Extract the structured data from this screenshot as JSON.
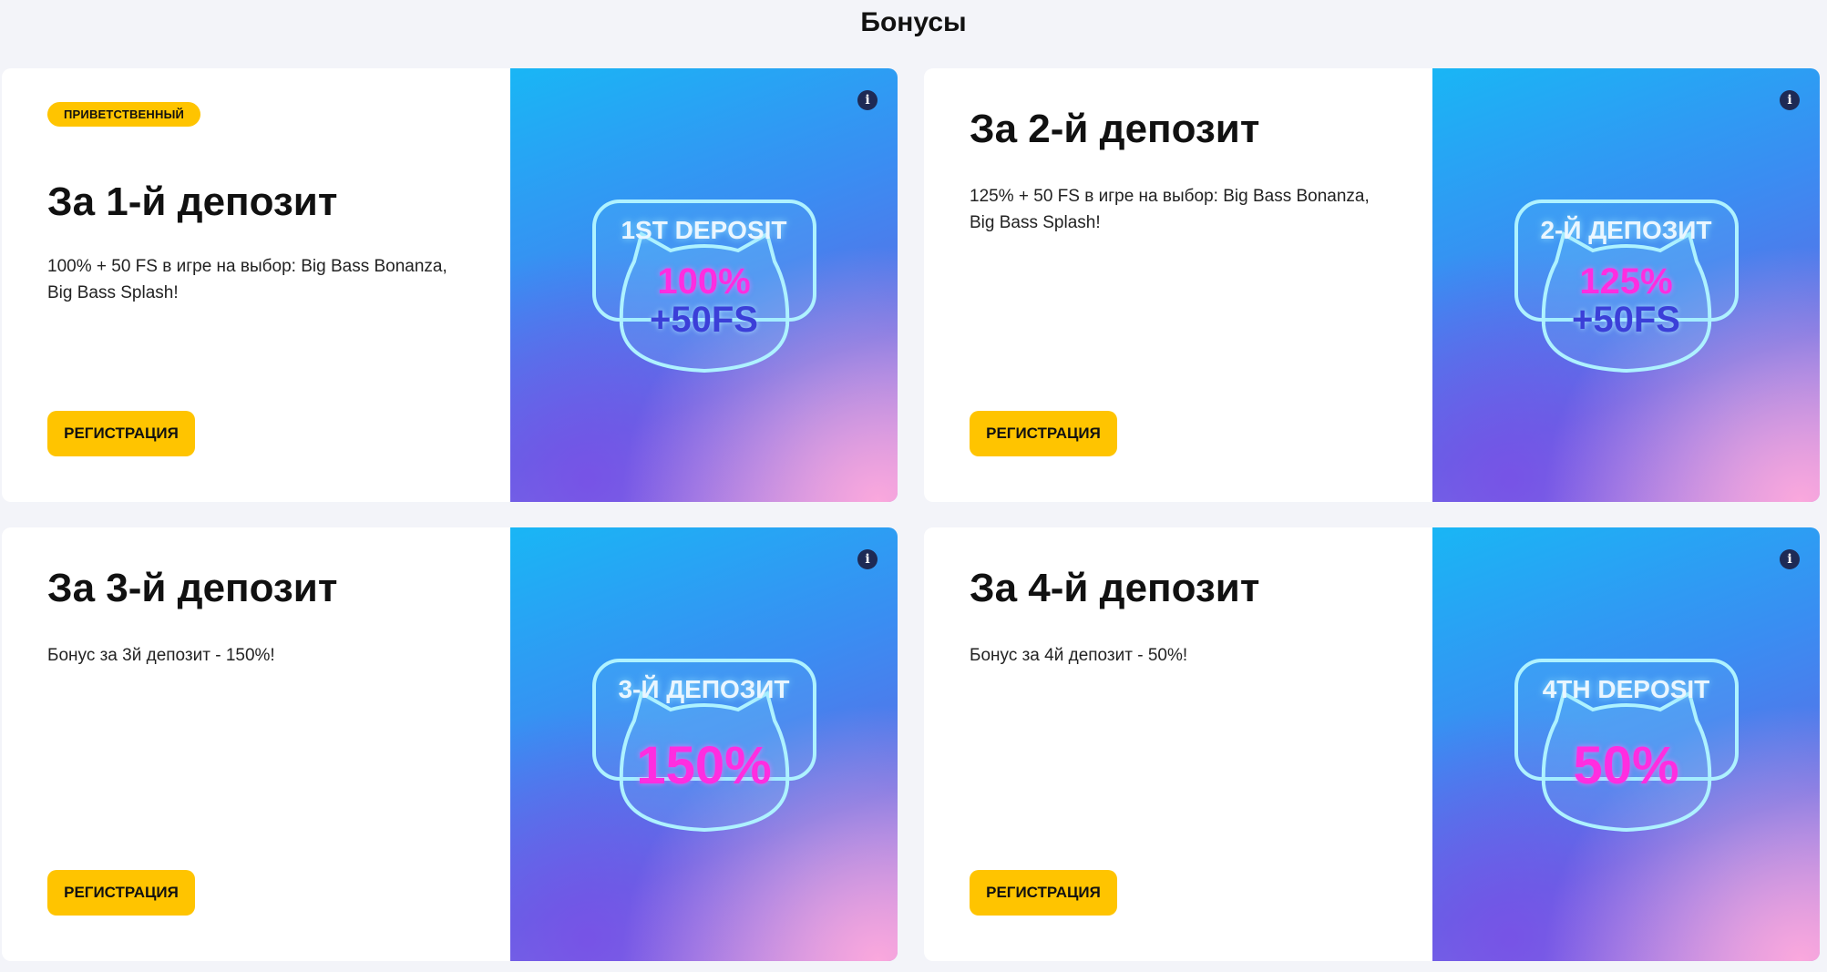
{
  "page": {
    "title": "Бонусы"
  },
  "cards": [
    {
      "badge": "ПРИВЕТСТВЕННЫЙ",
      "title": "За 1-й депозит",
      "description": "100% + 50 FS в игре на выбор: Big Bass Bonanza, Big Bass Splash!",
      "button": "РЕГИСТРАЦИЯ",
      "info_icon": "info-icon",
      "promo": {
        "label": "1ST DEPOSIT",
        "percent": "100%",
        "fs": "+50FS"
      }
    },
    {
      "title": "За 2-й депозит",
      "description": "125% + 50 FS в игре на выбор: Big Bass Bonanza, Big Bass Splash!",
      "button": "РЕГИСТРАЦИЯ",
      "info_icon": "info-icon",
      "promo": {
        "label": "2-Й ДЕПОЗИТ",
        "percent": "125%",
        "fs": "+50FS"
      }
    },
    {
      "title": "За 3-й депозит",
      "description": "Бонус за 3й депозит - 150%!",
      "button": "РЕГИСТРАЦИЯ",
      "info_icon": "info-icon",
      "promo": {
        "label": "3-Й ДЕПОЗИТ",
        "percent": "150%"
      }
    },
    {
      "title": "За 4-й депозит",
      "description": "Бонус за 4й депозит - 50%!",
      "button": "РЕГИСТРАЦИЯ",
      "info_icon": "info-icon",
      "promo": {
        "label": "4TH DEPOSIT",
        "percent": "50%"
      }
    }
  ],
  "colors": {
    "accent": "#ffc400",
    "background": "#f3f4f9",
    "promo_percent": "#ff2de0",
    "promo_fs": "#3b3fd8"
  }
}
